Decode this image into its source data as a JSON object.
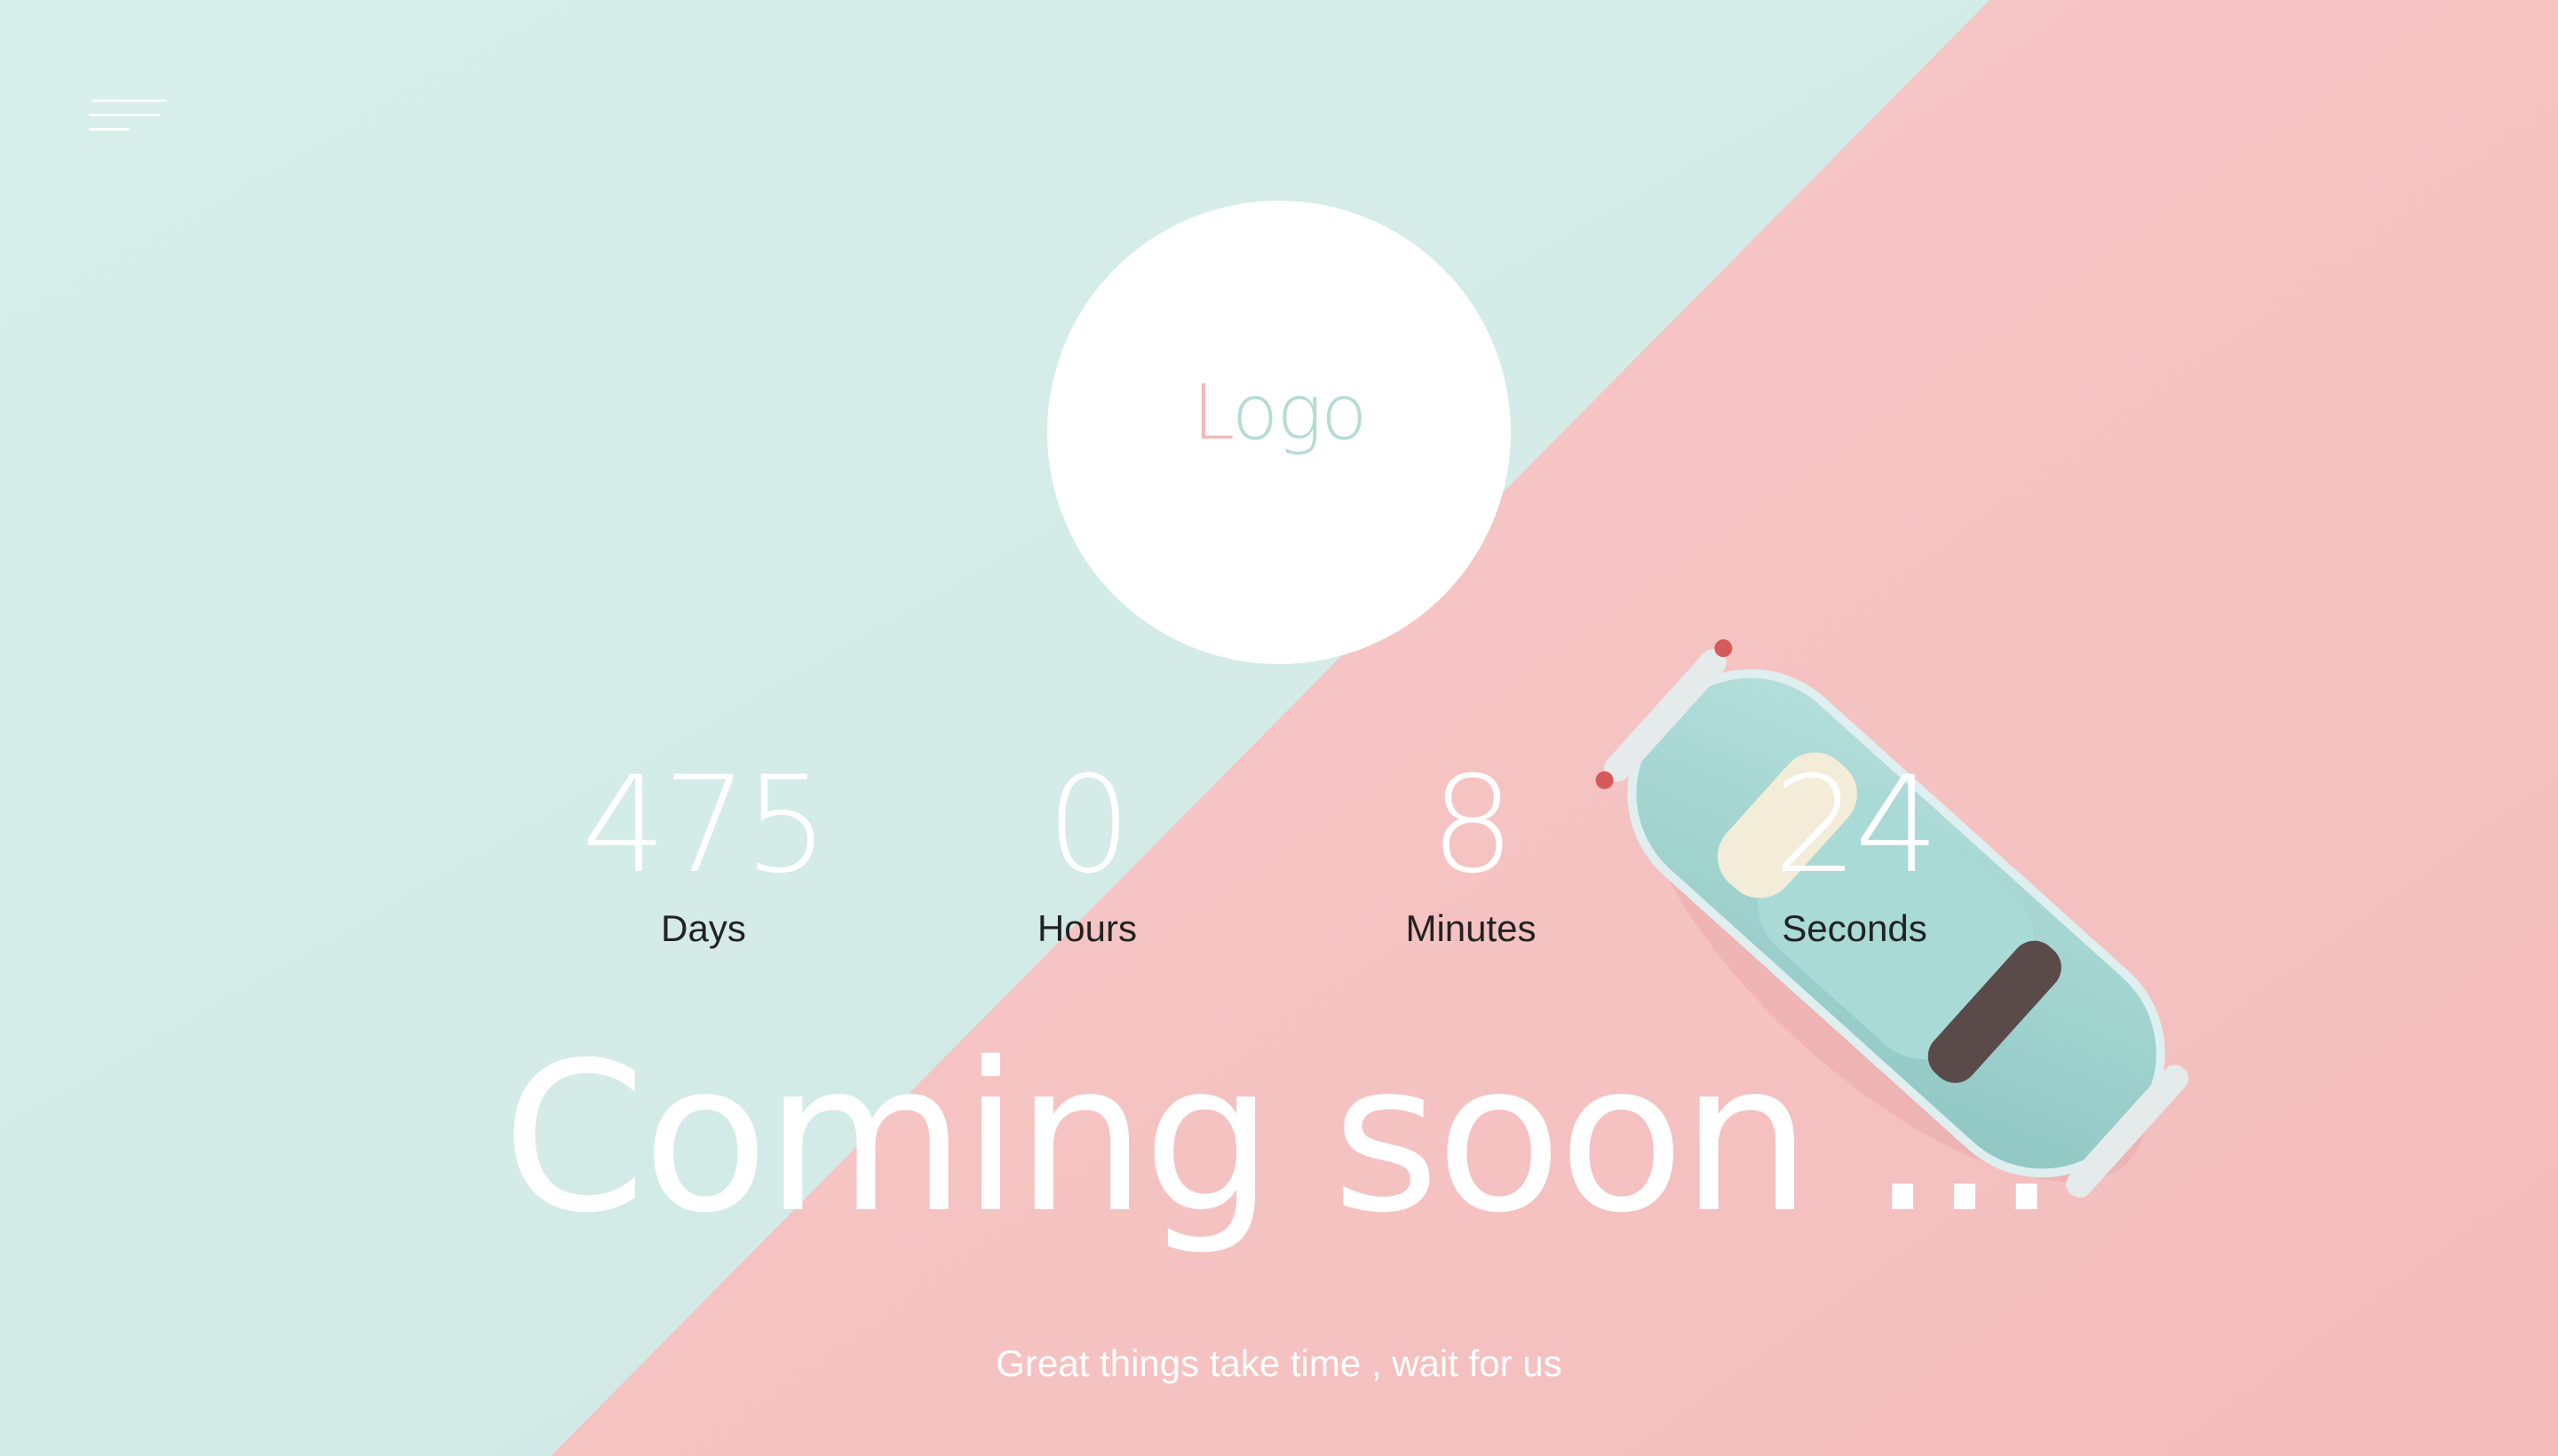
{
  "colors": {
    "mint": "#d5ece8",
    "pink": "#f6c4c4",
    "logo_pink": "#efb9b9",
    "logo_mint": "#b6dbd7",
    "car_body": "#9fd1cd"
  },
  "menu": {
    "icon": "hamburger-menu-icon"
  },
  "logo": {
    "part1": "L",
    "part2": "ogo"
  },
  "countdown": [
    {
      "value": "475",
      "label": "Days"
    },
    {
      "value": "0",
      "label": "Hours"
    },
    {
      "value": "8",
      "label": "Minutes"
    },
    {
      "value": "24",
      "label": "Seconds"
    }
  ],
  "headline": "Coming soon ...",
  "tagline": "Great things take time , wait for us",
  "image": {
    "subject": "toy-car-image"
  }
}
